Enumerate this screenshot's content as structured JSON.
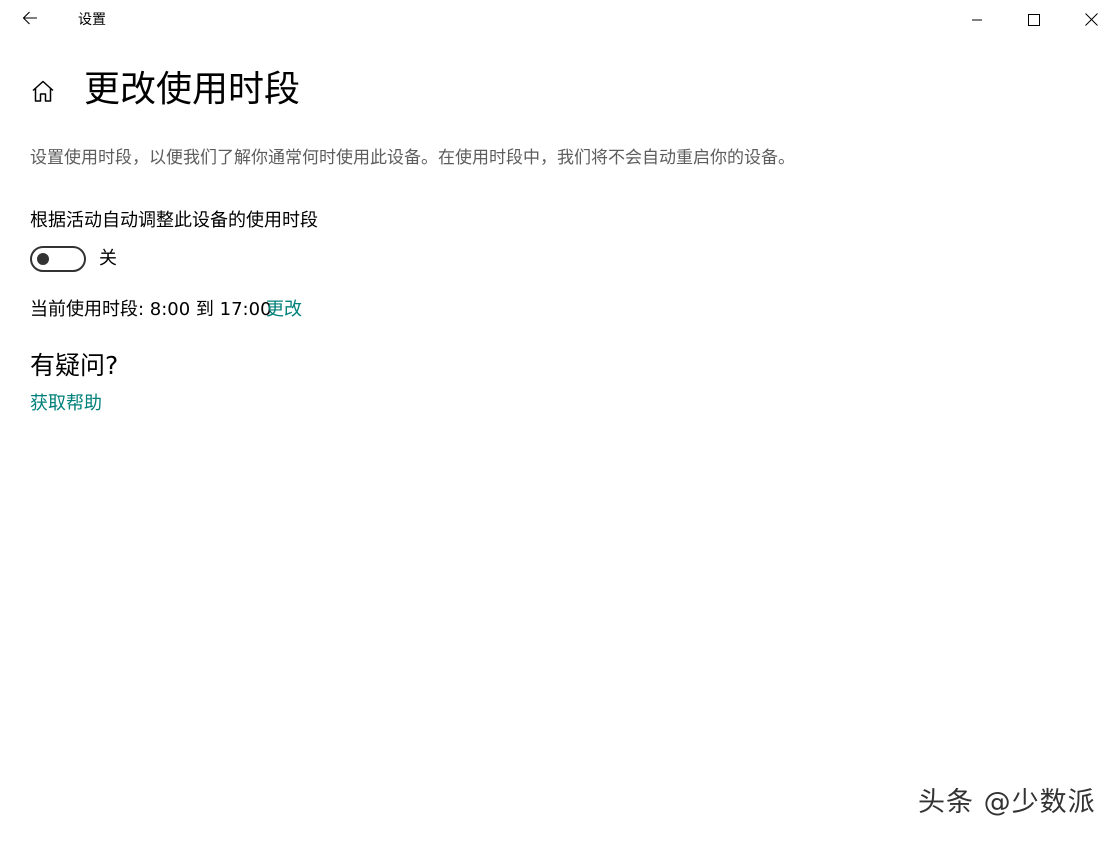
{
  "titlebar": {
    "app_title": "设置",
    "icons": {
      "back": "back-arrow-icon",
      "minimize": "minimize-icon",
      "maximize": "maximize-icon",
      "close": "close-icon"
    }
  },
  "header": {
    "home_icon": "home-icon",
    "title": "更改使用时段"
  },
  "main": {
    "description": "设置使用时段，以便我们了解你通常何时使用此设备。在使用时段中，我们将不会自动重启你的设备。",
    "auto_adjust": {
      "label": "根据活动自动调整此设备的使用时段",
      "state": "关",
      "enabled": false
    },
    "active_hours": {
      "text": "当前使用时段: 8:00 到 17:00",
      "change_link": "更改"
    },
    "faq": {
      "heading": "有疑问?",
      "help_link": "获取帮助"
    }
  },
  "watermark": "头条 @少数派",
  "colors": {
    "accent_link": "#00807a",
    "description_text": "#5d5d5d",
    "toggle_off": "#333333"
  }
}
